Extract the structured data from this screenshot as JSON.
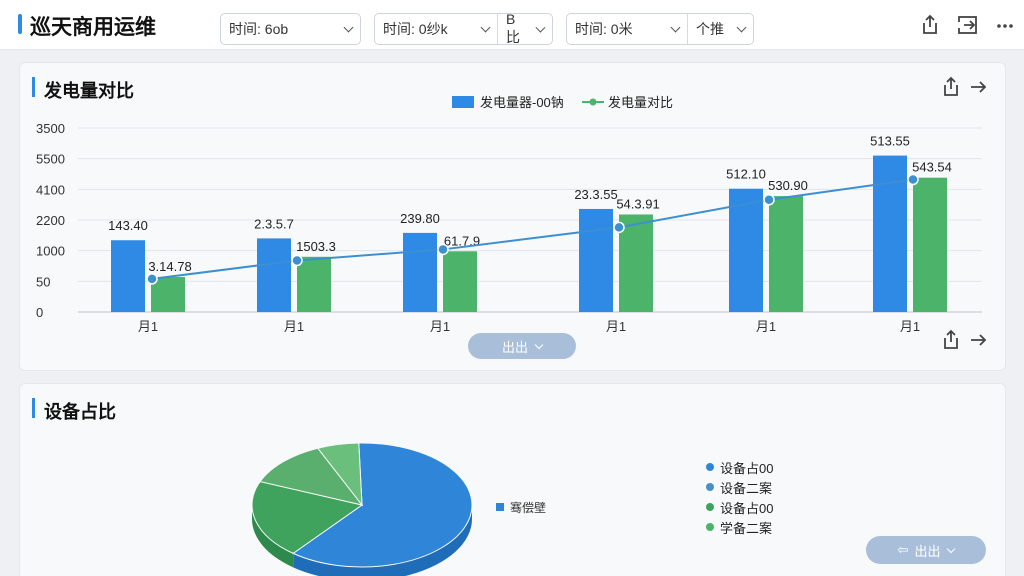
{
  "app": {
    "title": "巡天商用运维"
  },
  "filters": [
    {
      "label": "时间: 6ob"
    },
    {
      "label": "时间: 0纱k",
      "extra": "B比"
    },
    {
      "label": "时间: 0米",
      "extra": "个推"
    }
  ],
  "icons": {
    "top": [
      "share-icon",
      "export-icon",
      "more-icon"
    ]
  },
  "panel1": {
    "title": "发电量对比",
    "button": "出出",
    "chart_data": {
      "type": "bar",
      "categories": [
        "月1",
        "月1",
        "月1",
        "月1",
        "月1",
        "月1"
      ],
      "yticks": [
        "3500",
        "5500",
        "4100",
        "2200",
        "1000",
        "50",
        "0"
      ],
      "series": [
        {
          "name": "发电量器-00钠",
          "type": "bar",
          "color": "#2f8ae6",
          "values": [
            0.39,
            0.4,
            0.43,
            0.56,
            0.67,
            0.85
          ],
          "labels": [
            "143.40",
            "2.3.5.7",
            "239.80",
            "23.3.55",
            "512.10",
            "513.55"
          ]
        },
        {
          "name": "",
          "type": "bar",
          "color": "#4cb46a",
          "values": [
            0.19,
            0.3,
            0.33,
            0.53,
            0.63,
            0.73
          ],
          "labels": [
            "3.14.78",
            "1503.3",
            "61.7.9",
            "54.3.91",
            "530.90",
            "543.54"
          ]
        },
        {
          "name": "发电量对比",
          "type": "line",
          "color": "#3c8fd0",
          "values": [
            0.18,
            0.28,
            0.34,
            0.46,
            0.61,
            0.72
          ]
        }
      ]
    }
  },
  "panel2": {
    "title": "设备占比",
    "button": "出出",
    "chart_data": {
      "type": "pie",
      "values": [
        0.6,
        0.2,
        0.12,
        0.06
      ],
      "labels": [
        "设备占00",
        "设备二案",
        "设备占00",
        "学备二案"
      ],
      "colors": [
        "#2f86d8",
        "#3fa35e",
        "#5aaf6e",
        "#6bbf7d"
      ],
      "inner_label": "骞偿壁"
    }
  }
}
